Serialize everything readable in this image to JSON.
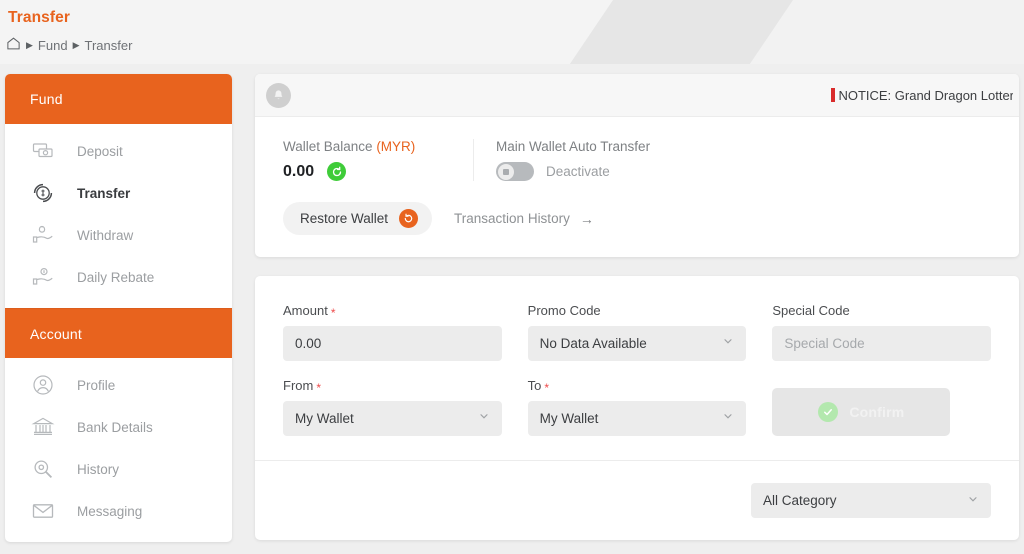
{
  "header": {
    "title": "Transfer",
    "breadcrumb": {
      "home_icon": "home-icon",
      "sep": "▶",
      "items": [
        "Fund",
        "Transfer"
      ]
    }
  },
  "sidebar": {
    "sections": [
      {
        "title": "Fund",
        "items": [
          {
            "label": "Deposit",
            "icon": "banknote-icon",
            "active": false
          },
          {
            "label": "Transfer",
            "icon": "transfer-circle-icon",
            "active": true
          },
          {
            "label": "Withdraw",
            "icon": "hand-money-icon",
            "active": false
          },
          {
            "label": "Daily Rebate",
            "icon": "hand-coin-icon",
            "active": false
          }
        ]
      },
      {
        "title": "Account",
        "items": [
          {
            "label": "Profile",
            "icon": "user-circle-icon",
            "active": false
          },
          {
            "label": "Bank Details",
            "icon": "bank-icon",
            "active": false
          },
          {
            "label": "History",
            "icon": "magnifier-icon",
            "active": false
          },
          {
            "label": "Messaging",
            "icon": "envelope-icon",
            "active": false
          }
        ]
      }
    ]
  },
  "notice": {
    "bell_icon": "bell-icon",
    "text": "NOTICE: Grand Dragon Lottery'"
  },
  "wallet": {
    "balance_label": "Wallet Balance",
    "currency": "(MYR)",
    "balance_value": "0.00",
    "refresh_icon": "refresh-icon",
    "auto_transfer_label": "Main Wallet Auto Transfer",
    "auto_transfer_state": "Deactivate",
    "auto_transfer_on": false,
    "restore_label": "Restore Wallet",
    "restore_icon": "restore-icon",
    "transaction_history_label": "Transaction History",
    "transaction_history_arrow": "→"
  },
  "form": {
    "amount": {
      "label": "Amount",
      "required": "*",
      "value": "0.00"
    },
    "promo_code": {
      "label": "Promo Code",
      "value": "No Data Available"
    },
    "special_code": {
      "label": "Special Code",
      "placeholder": "Special Code"
    },
    "from": {
      "label": "From",
      "required": "*",
      "value": "My Wallet"
    },
    "to": {
      "label": "To",
      "required": "*",
      "value": "My Wallet"
    },
    "confirm": {
      "label": "Confirm",
      "icon": "check-circle-icon"
    }
  },
  "filter": {
    "category": {
      "value": "All Category"
    }
  },
  "colors": {
    "brand_orange": "#e8631e",
    "required_red": "#ee4b4b",
    "notice_red": "#d92b2b",
    "refresh_green": "#3fcc39",
    "confirm_green": "#b3e8ae"
  }
}
